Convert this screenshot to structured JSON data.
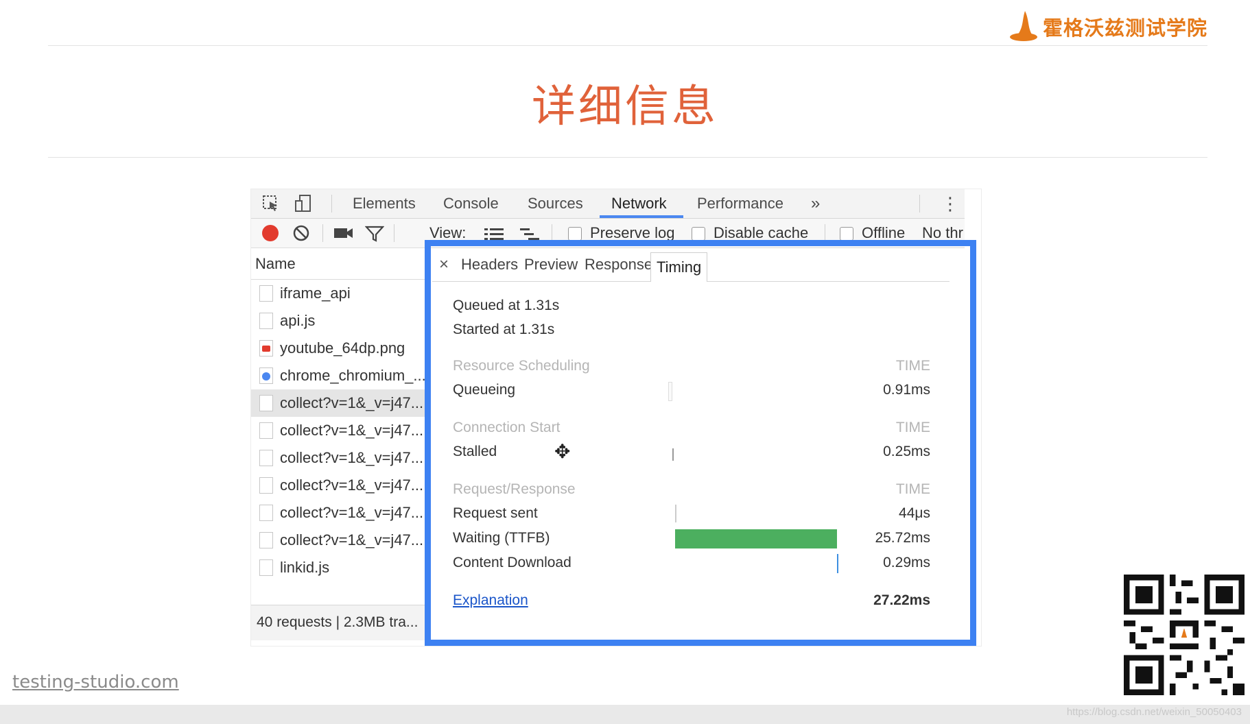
{
  "slide": {
    "title": "详细信息",
    "logo_text": "霍格沃兹测试学院",
    "footer_site": "testing-studio.com",
    "watermark": "https://blog.csdn.net/weixin_50050403"
  },
  "devtools": {
    "tabs": [
      "Elements",
      "Console",
      "Sources",
      "Network",
      "Performance"
    ],
    "active_tab": "Network",
    "more_tabs_glyph": "»",
    "menu_glyph": "⋮",
    "toolbar": {
      "view_label": "View:",
      "preserve_log_label": "Preserve log",
      "disable_cache_label": "Disable cache",
      "offline_label": "Offline",
      "throttle_label": "No thr"
    },
    "requests": {
      "column_header": "Name",
      "items": [
        {
          "name": "iframe_api",
          "icon": "file-icon"
        },
        {
          "name": "api.js",
          "icon": "file-icon"
        },
        {
          "name": "youtube_64dp.png",
          "icon": "youtube-icon"
        },
        {
          "name": "chrome_chromium_...",
          "icon": "chrome-icon"
        },
        {
          "name": "collect?v=1&_v=j47...",
          "icon": "file-icon",
          "selected": true
        },
        {
          "name": "collect?v=1&_v=j47...",
          "icon": "file-icon"
        },
        {
          "name": "collect?v=1&_v=j47...",
          "icon": "file-icon"
        },
        {
          "name": "collect?v=1&_v=j47...",
          "icon": "file-icon"
        },
        {
          "name": "collect?v=1&_v=j47...",
          "icon": "file-icon"
        },
        {
          "name": "collect?v=1&_v=j47...",
          "icon": "file-icon"
        },
        {
          "name": "linkid.js",
          "icon": "file-icon"
        }
      ],
      "status": "40 requests | 2.3MB tra..."
    },
    "detail": {
      "close_glyph": "×",
      "tabs": [
        "Headers",
        "Preview",
        "Response",
        "Timing"
      ],
      "active_tab": "Timing",
      "queued_at": "Queued at 1.31s",
      "started_at": "Started at 1.31s",
      "time_header": "TIME",
      "sections": {
        "resource_scheduling": "Resource Scheduling",
        "connection_start": "Connection Start",
        "request_response": "Request/Response"
      },
      "rows": {
        "queueing": {
          "label": "Queueing",
          "value": "0.91ms"
        },
        "stalled": {
          "label": "Stalled",
          "value": "0.25ms"
        },
        "request_sent": {
          "label": "Request sent",
          "value": "44μs"
        },
        "waiting": {
          "label": "Waiting (TTFB)",
          "value": "25.72ms"
        },
        "content_download": {
          "label": "Content Download",
          "value": "0.29ms"
        }
      },
      "explanation_label": "Explanation",
      "total": "27.22ms",
      "colors": {
        "waiting_bar": "#4caf5f",
        "download_bar": "#3d8fe0",
        "highlight_frame": "#3d81f2"
      }
    }
  }
}
